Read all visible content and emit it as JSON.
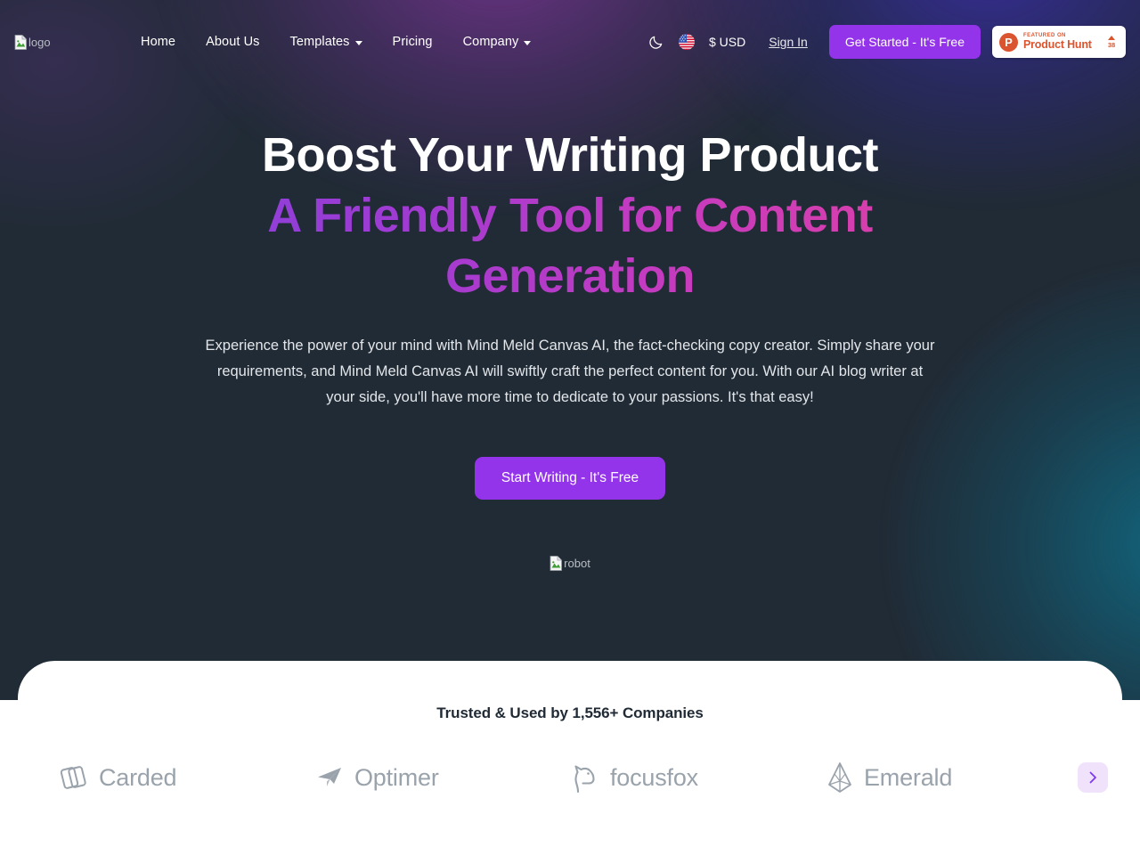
{
  "brand": {
    "logo_alt": "logo",
    "logo_icon": "broken-image-icon"
  },
  "nav": {
    "links": [
      {
        "label": "Home",
        "has_caret": false
      },
      {
        "label": "About Us",
        "has_caret": false
      },
      {
        "label": "Templates",
        "has_caret": true
      },
      {
        "label": "Pricing",
        "has_caret": false
      },
      {
        "label": "Company",
        "has_caret": true
      }
    ],
    "theme_toggle_icon": "moon-icon",
    "language_icon": "us-flag-icon",
    "currency": "$ USD",
    "sign_in": "Sign In",
    "get_started": "Get Started - It's Free",
    "product_hunt": {
      "logo_letter": "P",
      "featured_on": "FEATURED ON",
      "name": "Product Hunt",
      "upvotes": "38",
      "upvote_icon": "triangle-up-icon"
    }
  },
  "hero": {
    "headline_line1": "Boost Your Writing Product",
    "headline_line2": "A Friendly Tool for Content Generation",
    "subhead": "Experience the power of your mind with Mind Meld Canvas AI, the fact-checking copy creator. Simply share your requirements, and Mind Meld Canvas AI will swiftly craft the perfect content for you. With our AI blog writer at your side, you'll have more time to dedicate to your passions. It's that easy!",
    "cta_label": "Start Writing - It's Free",
    "image_alt": "robot",
    "image_icon": "broken-image-icon"
  },
  "trusted": {
    "title": "Trusted & Used by 1,556+ Companies",
    "logos": [
      {
        "label": "Carded",
        "icon": "overlapping-cards-icon"
      },
      {
        "label": "Optimer",
        "icon": "paper-plane-icon"
      },
      {
        "label": "focusfox",
        "icon": "fox-head-icon"
      },
      {
        "label": "Emerald",
        "icon": "gem-icon"
      }
    ],
    "next_icon": "chevron-right-icon"
  },
  "colors": {
    "background": "#212B36",
    "accent_purple": "#9333EA",
    "gradient_start": "#8B3FD9",
    "gradient_end": "#DB3FA8",
    "product_hunt_orange": "#DA552F",
    "panel_white": "#FFFFFF",
    "logo_gray": "#9AA3AB",
    "carousel_btn_bg": "#F0E2FB"
  }
}
